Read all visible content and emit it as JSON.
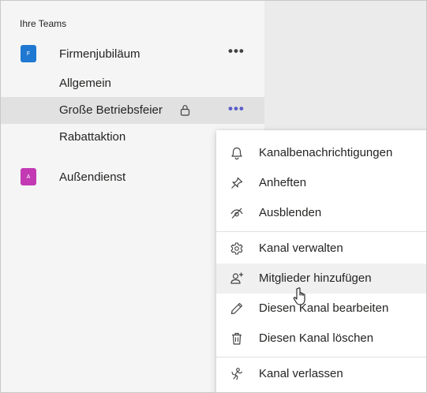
{
  "sidebar": {
    "header": "Ihre Teams",
    "teams": [
      {
        "initial": "F",
        "name": "Firmenjubiläum",
        "color": "#1f78d1",
        "more": "•••",
        "channels": [
          {
            "name": "Allgemein"
          },
          {
            "name": "Große Betriebsfeier",
            "locked": true,
            "selected": true,
            "more": "•••"
          },
          {
            "name": "Rabattaktion"
          }
        ]
      },
      {
        "initial": "A",
        "name": "Außendienst",
        "color": "#c239b3"
      }
    ]
  },
  "context_menu": {
    "items": [
      {
        "label": "Kanalbenachrichtigungen",
        "icon": "bell-icon"
      },
      {
        "label": "Anheften",
        "icon": "pin-icon"
      },
      {
        "label": "Ausblenden",
        "icon": "eye-off-icon"
      },
      {
        "label": "Kanal verwalten",
        "icon": "gear-icon"
      },
      {
        "label": "Mitglieder hinzufügen",
        "icon": "add-person-icon",
        "hovered": true
      },
      {
        "label": "Diesen Kanal bearbeiten",
        "icon": "pencil-icon"
      },
      {
        "label": "Diesen Kanal löschen",
        "icon": "trash-icon"
      },
      {
        "label": "Kanal verlassen",
        "icon": "leave-icon"
      }
    ]
  },
  "colors": {
    "accent": "#5b5fc7",
    "selected_bg": "#e1e1e1",
    "sidebar_bg": "#f5f5f5"
  }
}
